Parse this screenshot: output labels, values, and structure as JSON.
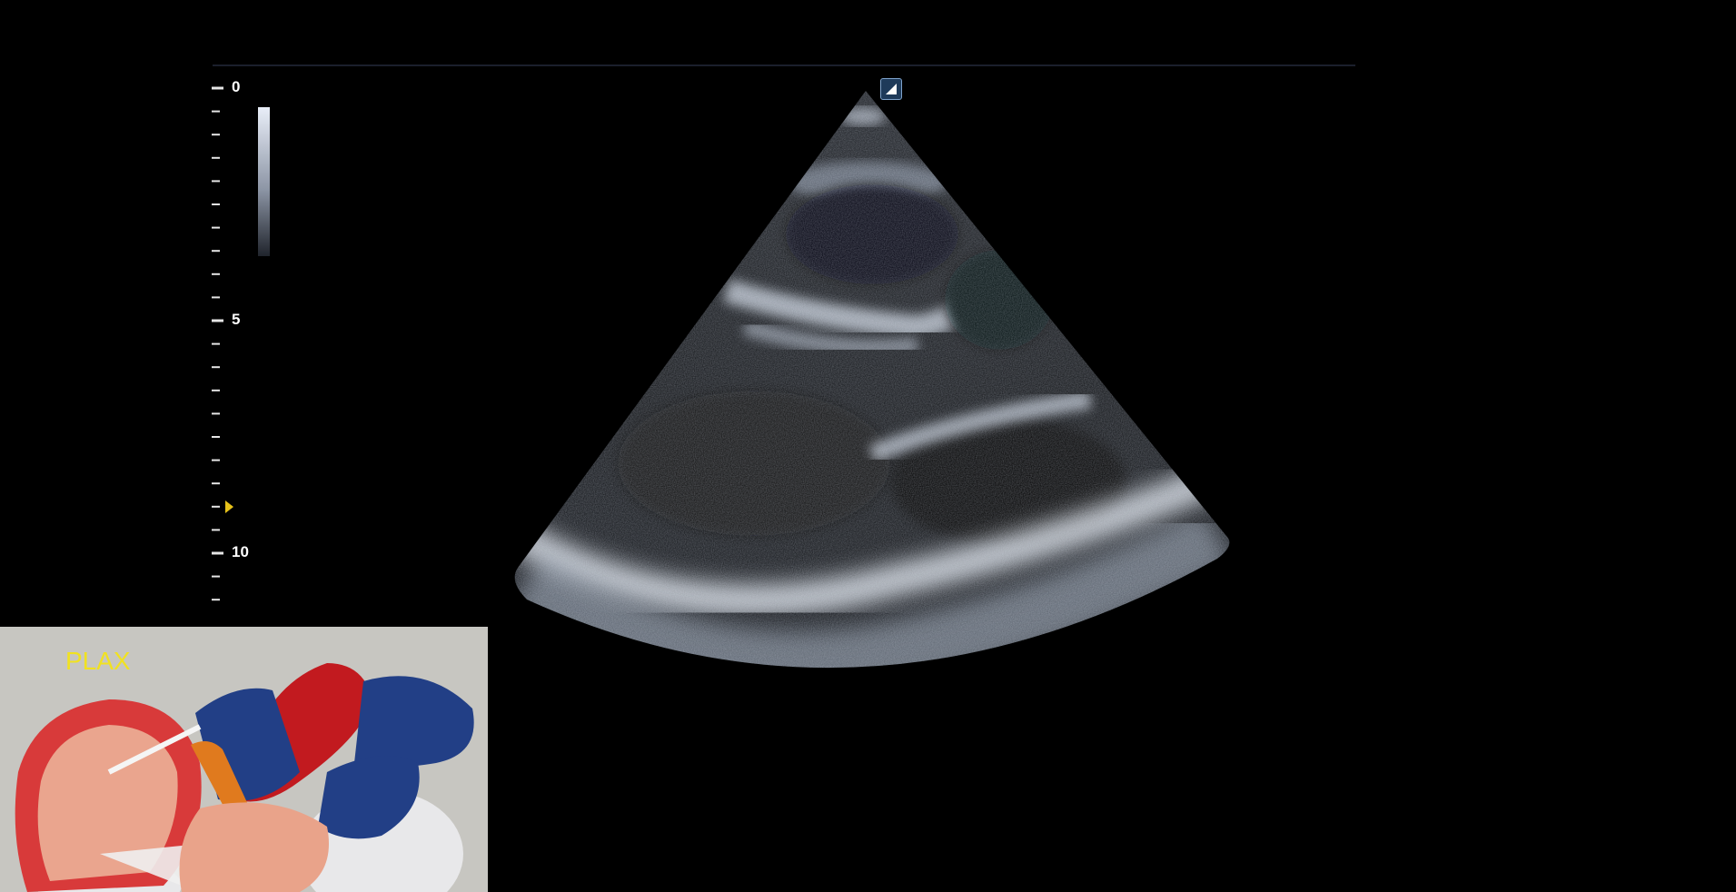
{
  "depth_scale": {
    "labels": [
      "0",
      "5",
      "10"
    ],
    "unit_max_cm": 10
  },
  "focus_depth_cm": 9,
  "probe_marker": {
    "icon": "orientation-marker-icon",
    "color": "#7fa3cc"
  },
  "thumbnail": {
    "view_label": "PLAX",
    "label_color": "#f1e220"
  }
}
